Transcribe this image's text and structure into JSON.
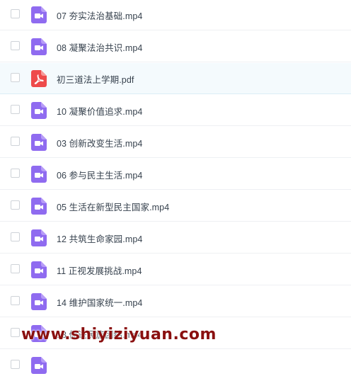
{
  "file_list": {
    "items": [
      {
        "name": "07 夯实法治基础.mp4",
        "icon": "video-file-icon"
      },
      {
        "name": "08 凝聚法治共识.mp4",
        "icon": "video-file-icon"
      },
      {
        "name": "初三道法上学期.pdf",
        "icon": "pdf-file-icon"
      },
      {
        "name": "10 凝聚价值追求.mp4",
        "icon": "video-file-icon"
      },
      {
        "name": "03 创新改变生活.mp4",
        "icon": "video-file-icon"
      },
      {
        "name": "06 参与民主生活.mp4",
        "icon": "video-file-icon"
      },
      {
        "name": "05 生活在新型民主国家.mp4",
        "icon": "video-file-icon"
      },
      {
        "name": "12 共筑生命家园.mp4",
        "icon": "video-file-icon"
      },
      {
        "name": "11 正视发展挑战.mp4",
        "icon": "video-file-icon"
      },
      {
        "name": "14 维护国家统一.mp4",
        "icon": "video-file-icon"
      },
      {
        "name": "13 促进民族团结.mp4",
        "icon": "video-file-icon"
      },
      {
        "name": "",
        "icon": "video-file-icon"
      }
    ]
  },
  "watermark": "www.shiyiziyuan.com",
  "colors": {
    "video_icon": "#8f6bf0",
    "pdf_icon": "#ee4b4b",
    "highlight_row": "#f4fafd",
    "watermark": "#8a1010"
  }
}
